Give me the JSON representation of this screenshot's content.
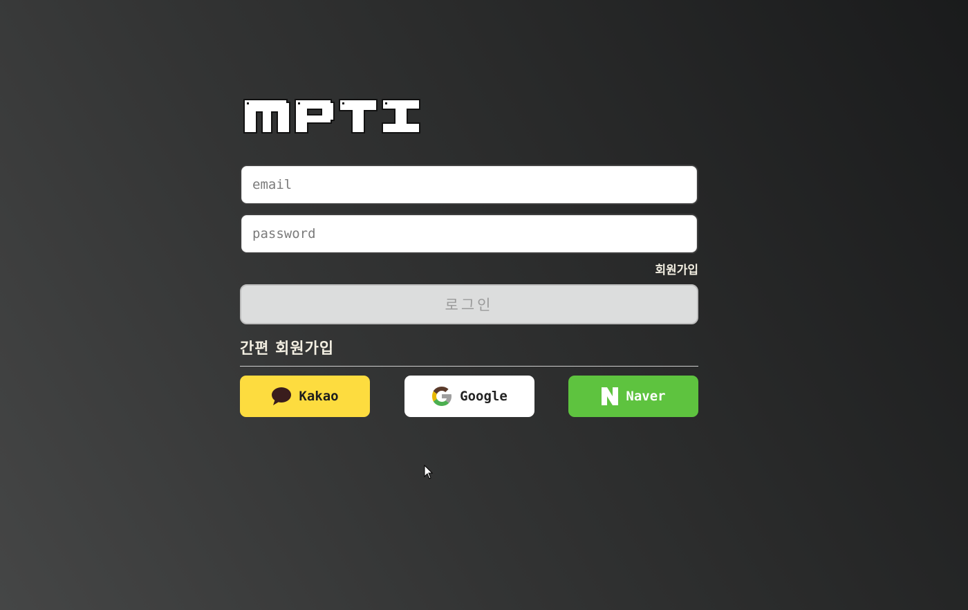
{
  "app": {
    "logo_text": "MPTI"
  },
  "login_form": {
    "email_placeholder": "email",
    "password_placeholder": "password",
    "signup_link": "회원가입",
    "login_button": "로그인"
  },
  "social_login": {
    "title": "간편 회원가입",
    "buttons": [
      {
        "label": "Kakao",
        "icon": "kakao-speech-bubble-icon",
        "color": "#fddc3f"
      },
      {
        "label": "Google",
        "icon": "google-g-icon",
        "color": "#ffffff"
      },
      {
        "label": "Naver",
        "icon": "naver-n-icon",
        "color": "#5ec33f"
      }
    ]
  },
  "colors": {
    "text_accent": "#f3efe2",
    "login_disabled_bg": "#dcdddd"
  }
}
